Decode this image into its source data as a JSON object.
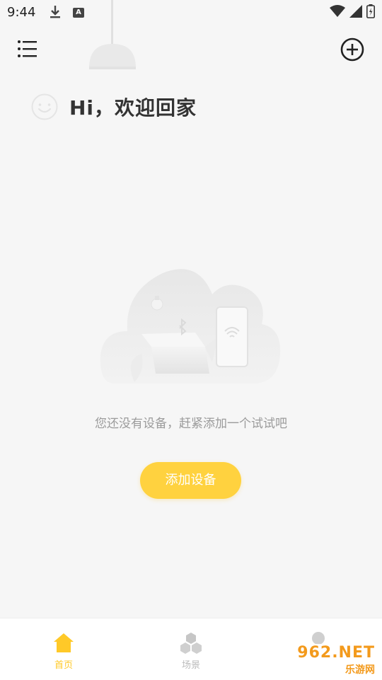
{
  "status_bar": {
    "time": "9:44",
    "badge_letter": "A",
    "icons": [
      "download-icon",
      "wifi-icon",
      "signal-icon",
      "battery-icon"
    ]
  },
  "header": {
    "menu_icon": "menu-icon",
    "add_icon": "add-circle-icon"
  },
  "greeting": {
    "text": "Hi，欢迎回家",
    "icon": "smile-icon"
  },
  "empty_state": {
    "illustration": "cloud-device-illustration",
    "message": "您还没有设备，赶紧添加一个试试吧",
    "button_label": "添加设备"
  },
  "bottom_nav": {
    "items": [
      {
        "label": "首页",
        "icon": "home-icon",
        "active": true
      },
      {
        "label": "场景",
        "icon": "scene-icon",
        "active": false
      },
      {
        "label": "",
        "icon": "profile-icon",
        "active": false
      }
    ],
    "active_color": "#ffc928",
    "inactive_color": "#bbbbbb"
  },
  "watermark": {
    "top": "962.NET",
    "bottom": "乐游网"
  },
  "colors": {
    "accent": "#ffd23f",
    "background": "#f6f6f6"
  }
}
